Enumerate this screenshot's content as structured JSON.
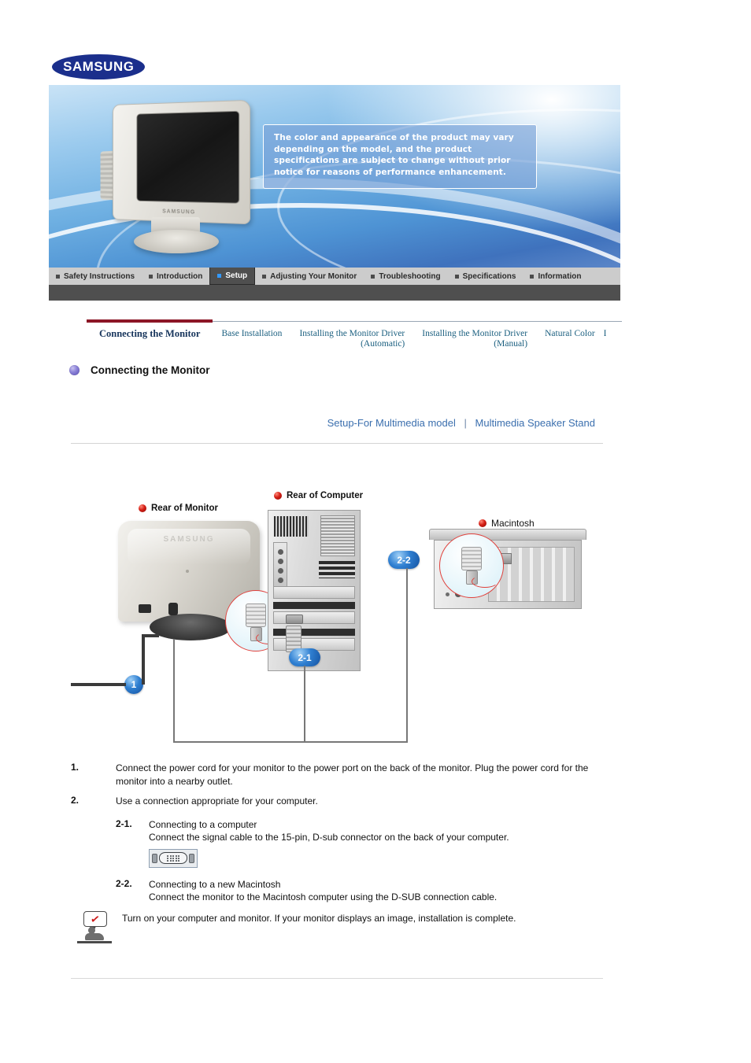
{
  "brand": {
    "logo_text": "SAMSUNG"
  },
  "banner": {
    "notice": "The color and appearance of the product may vary depending on the model, and the product specifications are subject to change without prior notice for reasons of performance enhancement.",
    "monitor_brand_label": "SAMSUNG"
  },
  "topnav": {
    "items": [
      {
        "label": "Safety Instructions",
        "active": false
      },
      {
        "label": "Introduction",
        "active": false
      },
      {
        "label": "Setup",
        "active": true
      },
      {
        "label": "Adjusting Your Monitor",
        "active": false
      },
      {
        "label": "Troubleshooting",
        "active": false
      },
      {
        "label": "Specifications",
        "active": false
      },
      {
        "label": "Information",
        "active": false
      }
    ]
  },
  "subnav": {
    "items": [
      {
        "line1": "Connecting the Monitor",
        "line2": "",
        "active": true
      },
      {
        "line1": "Base Installation",
        "line2": "",
        "active": false
      },
      {
        "line1": "Installing the Monitor Driver",
        "line2": "(Automatic)",
        "active": false
      },
      {
        "line1": "Installing the Monitor Driver",
        "line2": "(Manual)",
        "active": false
      },
      {
        "line1": "Natural Color",
        "line2": "",
        "active": false
      }
    ]
  },
  "page": {
    "title": "Connecting the Monitor",
    "links": [
      {
        "label": "Setup-For Multimedia model"
      },
      {
        "label": "Multimedia Speaker Stand"
      }
    ],
    "link_separator": "|"
  },
  "diagram": {
    "labels": [
      {
        "text": "Rear of Monitor"
      },
      {
        "text": "Rear of Computer"
      },
      {
        "text": "Macintosh"
      }
    ],
    "callouts": [
      {
        "label": "1"
      },
      {
        "label": "2-1"
      },
      {
        "label": "2-2"
      }
    ],
    "monitor_brand_label": "SAMSUNG"
  },
  "steps": [
    {
      "num": "1.",
      "text": "Connect the power cord for your monitor to the power port on the back of the monitor. Plug the power cord for the monitor into a nearby outlet."
    },
    {
      "num": "2.",
      "text": "Use a connection appropriate for your computer."
    }
  ],
  "substeps": [
    {
      "num": "2-1.",
      "title": "Connecting to a computer",
      "text": "Connect the signal cable to the 15-pin, D-sub connector on the back of your computer.",
      "icon": "dsub-connector-icon"
    },
    {
      "num": "2-2.",
      "title": "Connecting to a new Macintosh",
      "text": "Connect the monitor to the Macintosh computer using the D-SUB connection cable."
    }
  ],
  "note": {
    "text": "Turn on your computer and monitor. If your monitor displays an image, installation is complete.",
    "icon": "note-person-check-icon"
  },
  "colors": {
    "brand_blue": "#1b2f8c",
    "active_tab_bg": "#4f4f4f",
    "active_tab_marker": "#3399ff",
    "subnav_link": "#1c6080",
    "subnav_active": "#17355c",
    "subnav_underline": "#8c1626",
    "link_blue": "#3b6fae",
    "callout_blue": "#2f7fd1",
    "label_bullet_red": "#d41f16",
    "title_bullet_purple": "#5b50b5"
  }
}
